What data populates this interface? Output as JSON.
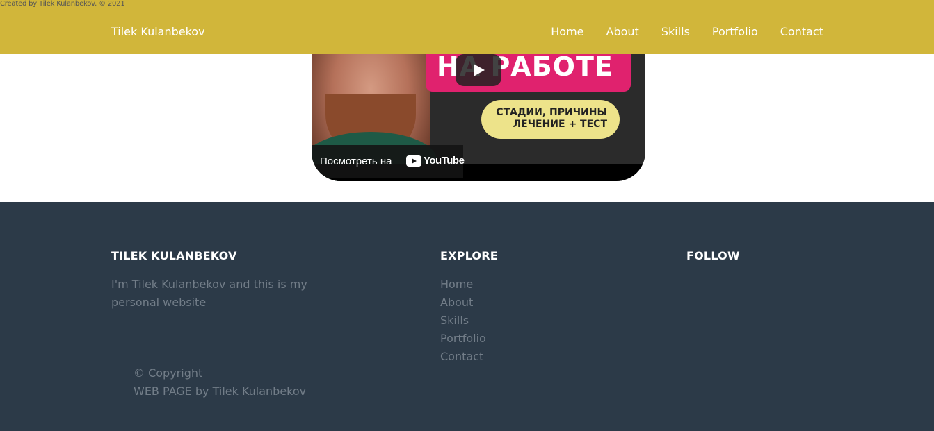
{
  "top_credit": "Created by Tilek Kulanbekov. © 2021",
  "nav": {
    "brand": "Tilek Kulanbekov",
    "links": [
      "Home",
      "About",
      "Skills",
      "Portfolio",
      "Contact"
    ]
  },
  "video": {
    "banner_text": "НА РАБОТЕ",
    "pill_line1": "СТАДИИ, ПРИЧИНЫ",
    "pill_line2": "ЛЕЧЕНИЕ + ТЕСТ",
    "watch_label": "Посмотреть на",
    "youtube_text": "YouTube"
  },
  "footer": {
    "about_title": "TILEK KULANBEKOV",
    "about_text": "I'm Tilek Kulanbekov and this is my personal website",
    "explore_title": "EXPLORE",
    "explore_links": [
      "Home",
      "About",
      "Skills",
      "Portfolio",
      "Contact"
    ],
    "follow_title": "FOLLOW",
    "copyright_line1": "© Copyright",
    "copyright_line2": "WEB PAGE by Tilek Kulanbekov"
  },
  "colors": {
    "navbar": "#d1b63a",
    "footer": "#2c3a48",
    "footer_text": "#727d88",
    "banner": "#e0226e",
    "pill": "#ede38a"
  }
}
